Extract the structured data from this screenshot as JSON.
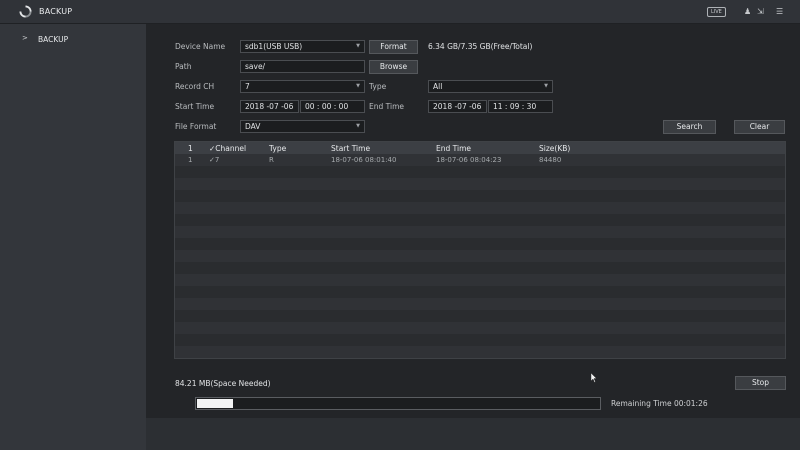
{
  "header": {
    "title": "BACKUP",
    "live_label": "LIVE",
    "icons": [
      "refresh-logo-icon",
      "user-icon",
      "logout-icon",
      "menu-icon"
    ],
    "user_glyph": "♟",
    "logout_glyph": "⇲",
    "menu_glyph": "☰"
  },
  "sidebar": {
    "items": [
      {
        "label": "BACKUP",
        "chevron": ">"
      }
    ]
  },
  "form": {
    "device_name_label": "Device Name",
    "device_name_value": "sdb1(USB USB)",
    "format_button": "Format",
    "capacity_text": "6.34 GB/7.35 GB(Free/Total)",
    "path_label": "Path",
    "path_value": "save/",
    "browse_button": "Browse",
    "record_ch_label": "Record CH",
    "record_ch_value": "7",
    "type_label": "Type",
    "type_value": "All",
    "start_time_label": "Start Time",
    "start_date": "2018 -07 -06",
    "start_time": "00 : 00 : 00",
    "end_time_label": "End Time",
    "end_date": "2018 -07 -06",
    "end_time": "11 : 09 : 30",
    "file_format_label": "File Format",
    "file_format_value": "DAV",
    "search_button": "Search",
    "clear_button": "Clear",
    "dropdown_arrow": "▼"
  },
  "table": {
    "headers": [
      "1",
      "✓Channel",
      "Type",
      "Start Time",
      "End Time",
      "Size(KB)"
    ],
    "rows": [
      [
        "1",
        "✓7",
        "R",
        "18-07-06 08:01:40",
        "18-07-06 08:04:23",
        "84480"
      ]
    ]
  },
  "footer": {
    "space_needed": "84.21 MB(Space Needed)",
    "stop_button": "Stop",
    "remaining_time": "Remaining Time 00:01:26",
    "progress_fraction": 0.09
  }
}
